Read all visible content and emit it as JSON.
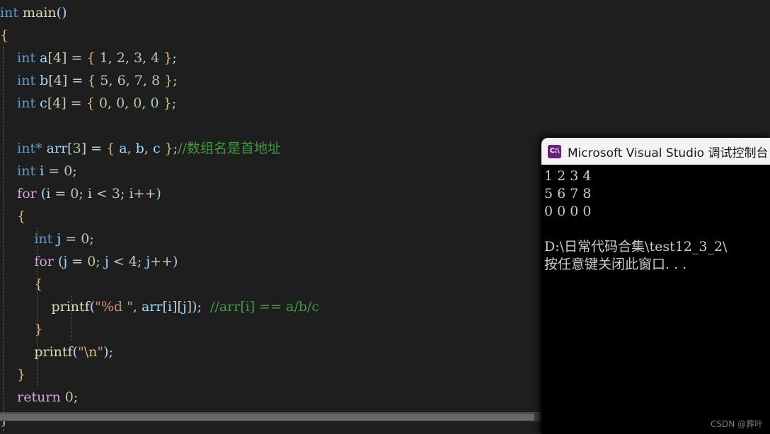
{
  "editor": {
    "background": "#1e1e1e",
    "lines": [
      {
        "indent": 0,
        "tokens": [
          {
            "t": "int",
            "c": "kw"
          },
          {
            "t": " ",
            "c": "punct"
          },
          {
            "t": "main",
            "c": "fn"
          },
          {
            "t": "()",
            "c": "paren"
          }
        ]
      },
      {
        "indent": 0,
        "tokens": [
          {
            "t": "{",
            "c": "brace"
          }
        ]
      },
      {
        "indent": 1,
        "tokens": [
          {
            "t": "int",
            "c": "kw"
          },
          {
            "t": " ",
            "c": "punct"
          },
          {
            "t": "a",
            "c": "var"
          },
          {
            "t": "[",
            "c": "brk"
          },
          {
            "t": "4",
            "c": "num"
          },
          {
            "t": "]",
            "c": "brk"
          },
          {
            "t": " = ",
            "c": "punct"
          },
          {
            "t": "{",
            "c": "brace"
          },
          {
            "t": " ",
            "c": "punct"
          },
          {
            "t": "1",
            "c": "num"
          },
          {
            "t": ", ",
            "c": "punct"
          },
          {
            "t": "2",
            "c": "num"
          },
          {
            "t": ", ",
            "c": "punct"
          },
          {
            "t": "3",
            "c": "num"
          },
          {
            "t": ", ",
            "c": "punct"
          },
          {
            "t": "4",
            "c": "num"
          },
          {
            "t": " ",
            "c": "punct"
          },
          {
            "t": "}",
            "c": "brace"
          },
          {
            "t": ";",
            "c": "punct"
          }
        ]
      },
      {
        "indent": 1,
        "tokens": [
          {
            "t": "int",
            "c": "kw"
          },
          {
            "t": " ",
            "c": "punct"
          },
          {
            "t": "b",
            "c": "var"
          },
          {
            "t": "[",
            "c": "brk"
          },
          {
            "t": "4",
            "c": "num"
          },
          {
            "t": "]",
            "c": "brk"
          },
          {
            "t": " = ",
            "c": "punct"
          },
          {
            "t": "{",
            "c": "brace"
          },
          {
            "t": " ",
            "c": "punct"
          },
          {
            "t": "5",
            "c": "num"
          },
          {
            "t": ", ",
            "c": "punct"
          },
          {
            "t": "6",
            "c": "num"
          },
          {
            "t": ", ",
            "c": "punct"
          },
          {
            "t": "7",
            "c": "num"
          },
          {
            "t": ", ",
            "c": "punct"
          },
          {
            "t": "8",
            "c": "num"
          },
          {
            "t": " ",
            "c": "punct"
          },
          {
            "t": "}",
            "c": "brace"
          },
          {
            "t": ";",
            "c": "punct"
          }
        ]
      },
      {
        "indent": 1,
        "tokens": [
          {
            "t": "int",
            "c": "kw"
          },
          {
            "t": " ",
            "c": "punct"
          },
          {
            "t": "c",
            "c": "var"
          },
          {
            "t": "[",
            "c": "brk"
          },
          {
            "t": "4",
            "c": "num"
          },
          {
            "t": "]",
            "c": "brk"
          },
          {
            "t": " = ",
            "c": "punct"
          },
          {
            "t": "{",
            "c": "brace"
          },
          {
            "t": " ",
            "c": "punct"
          },
          {
            "t": "0",
            "c": "num"
          },
          {
            "t": ", ",
            "c": "punct"
          },
          {
            "t": "0",
            "c": "num"
          },
          {
            "t": ", ",
            "c": "punct"
          },
          {
            "t": "0",
            "c": "num"
          },
          {
            "t": ", ",
            "c": "punct"
          },
          {
            "t": "0",
            "c": "num"
          },
          {
            "t": " ",
            "c": "punct"
          },
          {
            "t": "}",
            "c": "brace"
          },
          {
            "t": ";",
            "c": "punct"
          }
        ]
      },
      {
        "indent": 1,
        "tokens": []
      },
      {
        "indent": 1,
        "tokens": [
          {
            "t": "int*",
            "c": "kw"
          },
          {
            "t": " ",
            "c": "punct"
          },
          {
            "t": "arr",
            "c": "var"
          },
          {
            "t": "[",
            "c": "brk"
          },
          {
            "t": "3",
            "c": "num"
          },
          {
            "t": "]",
            "c": "brk"
          },
          {
            "t": " = ",
            "c": "punct"
          },
          {
            "t": "{",
            "c": "brace"
          },
          {
            "t": " ",
            "c": "punct"
          },
          {
            "t": "a",
            "c": "var"
          },
          {
            "t": ", ",
            "c": "punct"
          },
          {
            "t": "b",
            "c": "var"
          },
          {
            "t": ", ",
            "c": "punct"
          },
          {
            "t": "c",
            "c": "var"
          },
          {
            "t": " ",
            "c": "punct"
          },
          {
            "t": "}",
            "c": "brace"
          },
          {
            "t": ";",
            "c": "punct"
          },
          {
            "t": "//数组名是首地址",
            "c": "cmt"
          }
        ]
      },
      {
        "indent": 1,
        "tokens": [
          {
            "t": "int",
            "c": "kw"
          },
          {
            "t": " ",
            "c": "punct"
          },
          {
            "t": "i",
            "c": "var"
          },
          {
            "t": " = ",
            "c": "punct"
          },
          {
            "t": "0",
            "c": "num"
          },
          {
            "t": ";",
            "c": "punct"
          }
        ]
      },
      {
        "indent": 1,
        "tokens": [
          {
            "t": "for",
            "c": "ctrl"
          },
          {
            "t": " ",
            "c": "punct"
          },
          {
            "t": "(",
            "c": "paren"
          },
          {
            "t": "i",
            "c": "var"
          },
          {
            "t": " = ",
            "c": "punct"
          },
          {
            "t": "0",
            "c": "num"
          },
          {
            "t": "; ",
            "c": "punct"
          },
          {
            "t": "i",
            "c": "var"
          },
          {
            "t": " < ",
            "c": "op"
          },
          {
            "t": "3",
            "c": "num"
          },
          {
            "t": "; ",
            "c": "punct"
          },
          {
            "t": "i",
            "c": "var"
          },
          {
            "t": "++",
            "c": "op"
          },
          {
            "t": ")",
            "c": "paren"
          }
        ]
      },
      {
        "indent": 1,
        "tokens": [
          {
            "t": "{",
            "c": "brace"
          }
        ]
      },
      {
        "indent": 2,
        "tokens": [
          {
            "t": "int",
            "c": "kw"
          },
          {
            "t": " ",
            "c": "punct"
          },
          {
            "t": "j",
            "c": "var"
          },
          {
            "t": " = ",
            "c": "punct"
          },
          {
            "t": "0",
            "c": "num"
          },
          {
            "t": ";",
            "c": "punct"
          }
        ]
      },
      {
        "indent": 2,
        "tokens": [
          {
            "t": "for",
            "c": "ctrl"
          },
          {
            "t": " ",
            "c": "punct"
          },
          {
            "t": "(",
            "c": "paren"
          },
          {
            "t": "j",
            "c": "var"
          },
          {
            "t": " = ",
            "c": "punct"
          },
          {
            "t": "0",
            "c": "num"
          },
          {
            "t": "; ",
            "c": "punct"
          },
          {
            "t": "j",
            "c": "var"
          },
          {
            "t": " < ",
            "c": "op"
          },
          {
            "t": "4",
            "c": "num"
          },
          {
            "t": "; ",
            "c": "punct"
          },
          {
            "t": "j",
            "c": "var"
          },
          {
            "t": "++",
            "c": "op"
          },
          {
            "t": ")",
            "c": "paren"
          }
        ]
      },
      {
        "indent": 2,
        "tokens": [
          {
            "t": "{",
            "c": "brace"
          }
        ]
      },
      {
        "indent": 3,
        "tokens": [
          {
            "t": "printf",
            "c": "fn"
          },
          {
            "t": "(",
            "c": "paren"
          },
          {
            "t": "\"%d \"",
            "c": "str"
          },
          {
            "t": ", ",
            "c": "punct"
          },
          {
            "t": "arr",
            "c": "var"
          },
          {
            "t": "[",
            "c": "brk"
          },
          {
            "t": "i",
            "c": "var"
          },
          {
            "t": "]",
            "c": "brk"
          },
          {
            "t": "[",
            "c": "brk"
          },
          {
            "t": "j",
            "c": "var"
          },
          {
            "t": "]",
            "c": "brk"
          },
          {
            "t": ")",
            "c": "paren"
          },
          {
            "t": ";  ",
            "c": "punct"
          },
          {
            "t": "//arr[i] == a/b/c",
            "c": "cmt"
          }
        ]
      },
      {
        "indent": 2,
        "tokens": [
          {
            "t": "}",
            "c": "brace"
          }
        ]
      },
      {
        "indent": 2,
        "tokens": [
          {
            "t": "printf",
            "c": "fn"
          },
          {
            "t": "(",
            "c": "paren"
          },
          {
            "t": "\"",
            "c": "str"
          },
          {
            "t": "\\n",
            "c": "esc"
          },
          {
            "t": "\"",
            "c": "str"
          },
          {
            "t": ")",
            "c": "paren"
          },
          {
            "t": ";",
            "c": "punct"
          }
        ]
      },
      {
        "indent": 1,
        "tokens": [
          {
            "t": "}",
            "c": "brace"
          }
        ]
      },
      {
        "indent": 1,
        "tokens": [
          {
            "t": "return",
            "c": "ctrl"
          },
          {
            "t": " ",
            "c": "punct"
          },
          {
            "t": "0",
            "c": "num"
          },
          {
            "t": ";",
            "c": "punct"
          }
        ]
      },
      {
        "indent": 0,
        "tokens": [
          {
            "t": "}",
            "c": "brace"
          }
        ]
      }
    ]
  },
  "console": {
    "title": "Microsoft Visual Studio 调试控制台",
    "icon": "vs-console-icon",
    "icon_glyph": "C:\\",
    "output_lines": [
      "1 2 3 4",
      "5 6 7 8",
      "0 0 0 0",
      "",
      "D:\\日常代码合集\\test12_3_2\\",
      "按任意键关闭此窗口. . ."
    ]
  },
  "watermark": {
    "text": "CSDN @葬叶"
  }
}
